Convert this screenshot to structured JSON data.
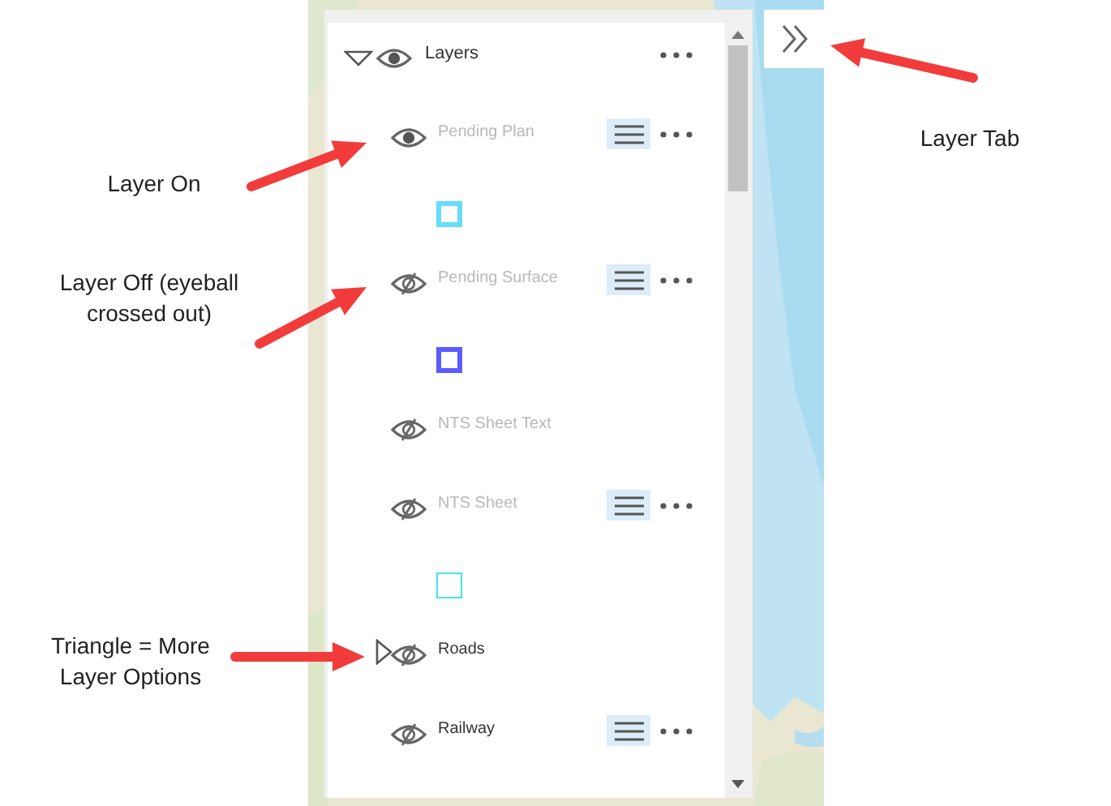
{
  "annotations": [
    {
      "text": "Layer On"
    },
    {
      "text": "Layer Off (eyeball crossed out)"
    },
    {
      "text": "Triangle = More Layer Options"
    },
    {
      "text": "Layer Tab"
    }
  ],
  "layer_list": {
    "title": "Layers",
    "visible": true,
    "expanded": true,
    "layers": [
      {
        "label": "Pending Plan",
        "kind": "layer",
        "visible": true,
        "greyed": true,
        "legend_button": true,
        "swatch": {
          "color": "#66dcff",
          "kind": "thick"
        }
      },
      {
        "label": "Pending Surface",
        "kind": "layer",
        "visible": false,
        "greyed": true,
        "legend_button": true,
        "swatch": {
          "color": "#5b5bff",
          "kind": "thick"
        }
      },
      {
        "label": "NTS Sheet Text",
        "kind": "layer",
        "visible": false,
        "greyed": true,
        "legend_button": false
      },
      {
        "label": "NTS Sheet",
        "kind": "layer",
        "visible": false,
        "greyed": true,
        "legend_button": true,
        "swatch": {
          "color": "#44e4f4",
          "kind": "thin"
        }
      },
      {
        "label": "Roads",
        "kind": "group",
        "expanded": false,
        "visible": false,
        "greyed": false,
        "legend_button": false
      },
      {
        "label": "Railway",
        "kind": "layer",
        "visible": false,
        "greyed": false,
        "legend_button": true
      }
    ]
  }
}
